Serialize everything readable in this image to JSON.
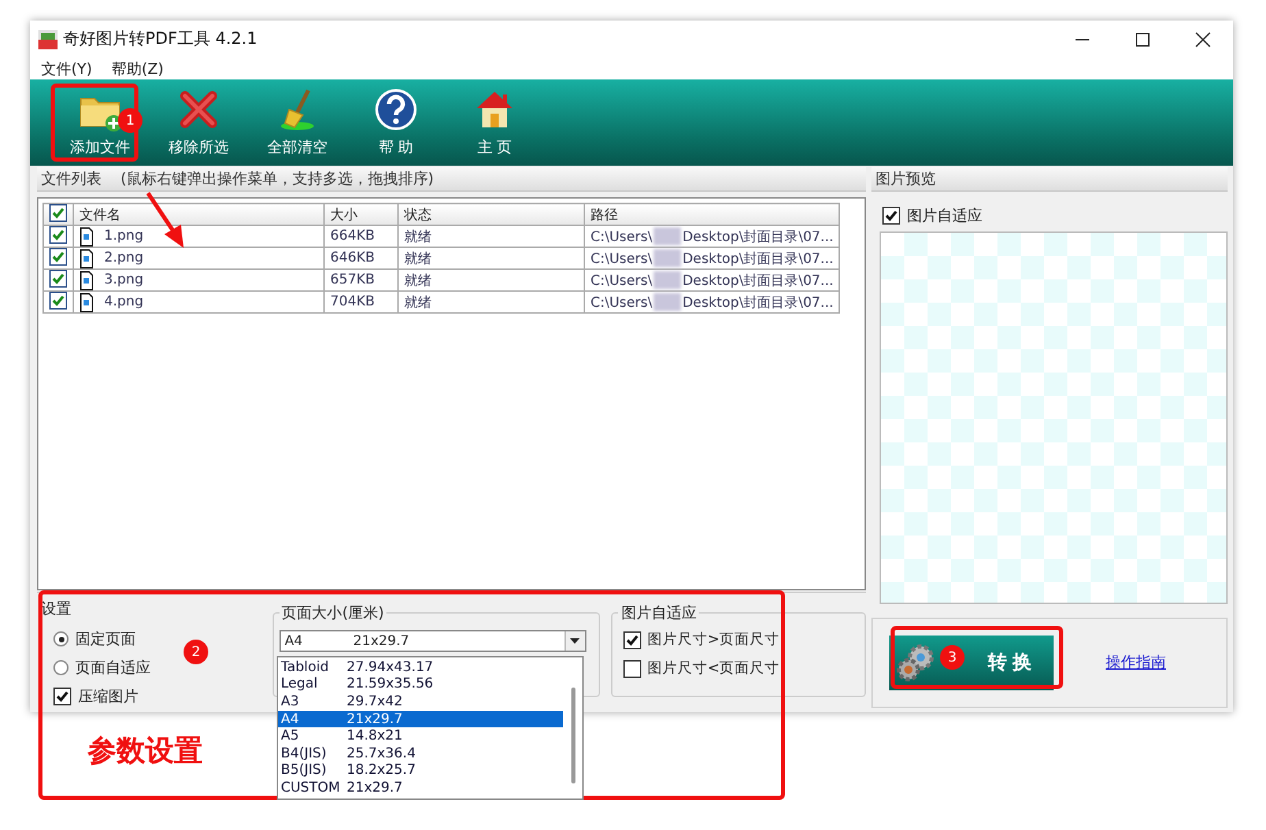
{
  "window": {
    "title": "奇好图片转PDF工具 4.2.1"
  },
  "menu": [
    "文件(Y)",
    "帮助(Z)"
  ],
  "toolbar": [
    {
      "label": "添加文件",
      "kind": "add"
    },
    {
      "label": "移除所选",
      "kind": "remove"
    },
    {
      "label": "全部清空",
      "kind": "clear"
    },
    {
      "label": "帮 助",
      "kind": "help"
    },
    {
      "label": "主 页",
      "kind": "home"
    }
  ],
  "file_list": {
    "title": "文件列表",
    "hint": "(鼠标右键弹出操作菜单，支持多选，拖拽排序)",
    "all_checked": true,
    "columns": [
      "文件名",
      "大小",
      "状态",
      "路径"
    ],
    "rows": [
      {
        "checked": true,
        "name": "1.png",
        "size": "664KB",
        "status": "就绪",
        "path_start": "C:\\Users\\",
        "path_end": "Desktop\\封面目录\\07..."
      },
      {
        "checked": true,
        "name": "2.png",
        "size": "646KB",
        "status": "就绪",
        "path_start": "C:\\Users\\",
        "path_end": "Desktop\\封面目录\\07..."
      },
      {
        "checked": true,
        "name": "3.png",
        "size": "657KB",
        "status": "就绪",
        "path_start": "C:\\Users\\",
        "path_end": "Desktop\\封面目录\\07..."
      },
      {
        "checked": true,
        "name": "4.png",
        "size": "704KB",
        "status": "就绪",
        "path_start": "C:\\Users\\",
        "path_end": "Desktop\\封面目录\\07..."
      }
    ]
  },
  "preview": {
    "title": "图片预览",
    "fit": {
      "label": "图片自适应",
      "checked": true
    }
  },
  "settings": {
    "title": "设置",
    "page_modes": [
      {
        "label": "固定页面",
        "selected": true
      },
      {
        "label": "页面自适应",
        "selected": false
      }
    ],
    "compress": {
      "label": "压缩图片",
      "checked": true
    },
    "page_size": {
      "title": "页面大小(厘米)",
      "value_name": "A4",
      "value_size": "21x29.7",
      "options": [
        {
          "name": "Tabloid",
          "size": "27.94x43.17",
          "selected": false
        },
        {
          "name": "Legal",
          "size": "21.59x35.56",
          "selected": false
        },
        {
          "name": "A3",
          "size": "29.7x42",
          "selected": false
        },
        {
          "name": "A4",
          "size": "21x29.7",
          "selected": true
        },
        {
          "name": "A5",
          "size": "14.8x21",
          "selected": false
        },
        {
          "name": "B4(JIS)",
          "size": "25.7x36.4",
          "selected": false
        },
        {
          "name": "B5(JIS)",
          "size": "18.2x25.7",
          "selected": false
        },
        {
          "name": "CUSTOM",
          "size": "21x29.7",
          "selected": false
        }
      ]
    },
    "image_fit": {
      "title": "图片自适应",
      "options": [
        {
          "label": "图片尺寸>页面尺寸",
          "checked": true
        },
        {
          "label": "图片尺寸<页面尺寸",
          "checked": false
        }
      ]
    }
  },
  "convert_button": "转换",
  "guide_link": "操作指南",
  "annotations": {
    "badges": [
      "1",
      "2",
      "3"
    ],
    "caption": "参数设置"
  }
}
